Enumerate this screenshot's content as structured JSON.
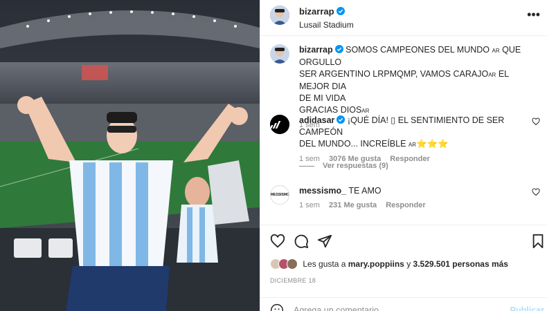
{
  "post": {
    "username": "bizarrap",
    "location": "Lusail Stadium",
    "more_icon": "more-options-icon"
  },
  "caption": {
    "username": "bizarrap",
    "text_line1": "SOMOS CAMPEONES DEL MUNDO",
    "flag1": "AR",
    "text_line1b": "QUE ORGULLO",
    "text_line2": "SER ARGENTINO LRPMQMP, VAMOS CARAJO",
    "flag2": "AR",
    "text_line2b": "EL MEJOR DIA",
    "text_line3": "DE MI VIDA",
    "text_line4": "GRACIAS DIOS",
    "flag3": "AR",
    "time": "1 sem"
  },
  "comments": [
    {
      "username": "adidasar",
      "verified": true,
      "text_a": "¡QUÉ DÍA! ▯ EL SENTIMIENTO DE SER CAMPEÓN",
      "text_b": "DEL MUNDO... INCREÍBLE",
      "flag": "AR",
      "stars": "⭐⭐⭐",
      "time": "1 sem",
      "likes": "3076 Me gusta",
      "reply": "Responder",
      "view_replies": "Ver respuestas (9)"
    },
    {
      "username": "messismo_",
      "verified": false,
      "text": "TE AMO",
      "avatar_label": "MESSISMO",
      "time": "1 sem",
      "likes": "231 Me gusta",
      "reply": "Responder"
    }
  ],
  "likes_line": {
    "prefix": "Les gusta a",
    "user": "mary.poppiins",
    "connector": "y",
    "count": "3.529.501 personas más"
  },
  "date": "DICIEMBRE 18",
  "add_comment": {
    "placeholder": "Agrega un comentario...",
    "publish": "Publicar"
  },
  "colors": {
    "verified": "#0095f6",
    "publish": "#b2dffc",
    "meta_gray": "#8e8e8e"
  }
}
